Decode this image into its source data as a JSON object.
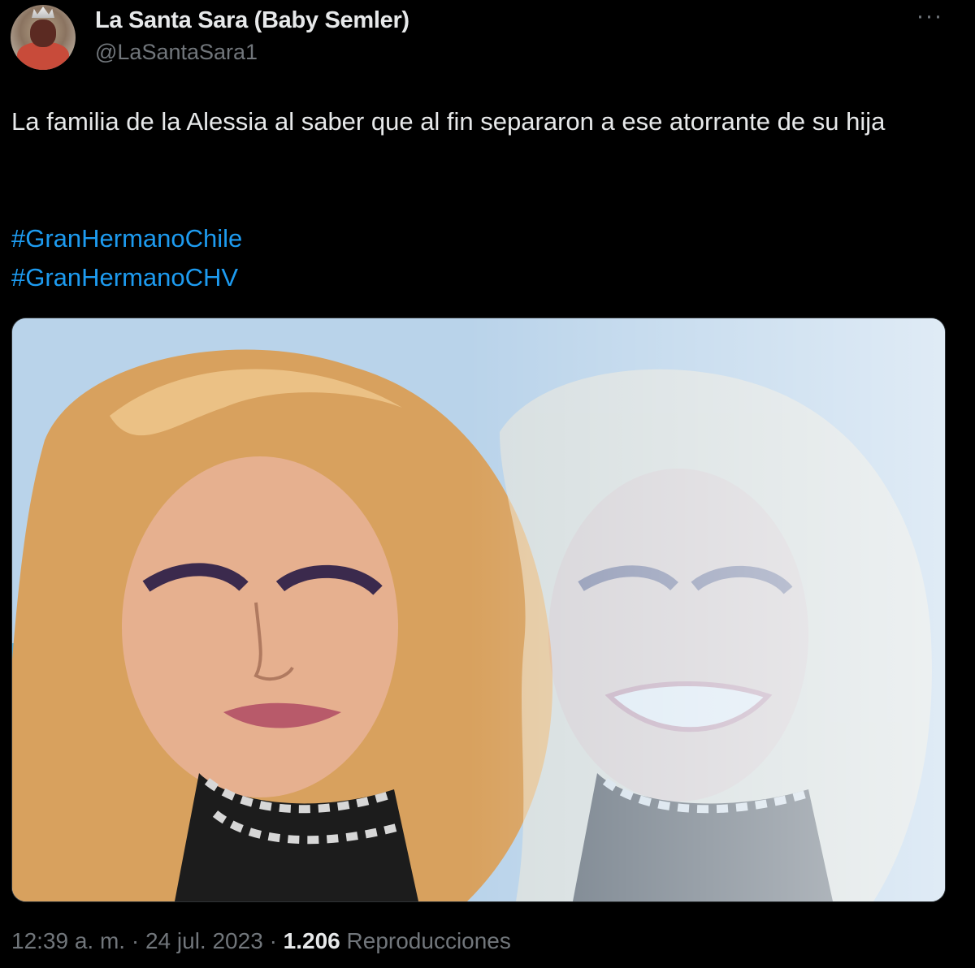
{
  "tweet": {
    "author": {
      "display_name": "La Santa Sara (Baby Semler)",
      "handle": "@LaSantaSara1"
    },
    "more_icon": "more-horizontal-icon",
    "text": "La familia de la Alessia al saber que al fin separaron a ese atorrante de su hija",
    "hashtags": [
      "#GranHermanoChile",
      "#GranHermanoCHV"
    ],
    "media": {
      "type": "image"
    },
    "footer": {
      "time": "12:39 a. m.",
      "separator": "·",
      "date": "24 jul. 2023",
      "views_count": "1.206",
      "views_label": "Reproducciones"
    }
  }
}
